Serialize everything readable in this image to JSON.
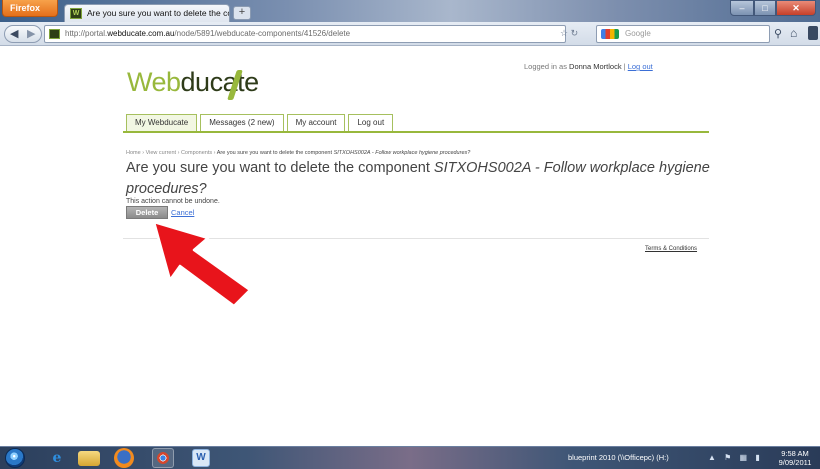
{
  "browser": {
    "app_button": "Firefox",
    "tab_title": "Are you sure you want to delete the com...",
    "new_tab_label": "+",
    "url_prefix": "http://portal.",
    "url_host": "webducate.com.au",
    "url_path": "/node/5891/webducate-components/41526/delete",
    "search_placeholder": "Google"
  },
  "header": {
    "logo_web": "Web",
    "logo_rest": "ducate",
    "logged_in_prefix": "Logged in as",
    "user_name": "Donna Mortlock",
    "separator": "|",
    "logout_link": "Log out"
  },
  "menu": {
    "items": [
      {
        "label": "My Webducate"
      },
      {
        "label": "Messages (2 new)"
      },
      {
        "label": "My account"
      },
      {
        "label": "Log out"
      }
    ]
  },
  "breadcrumb": {
    "home": "Home",
    "view_current": "View current",
    "components": "Components",
    "sep": "›",
    "current_prefix": "Are you sure you want to delete the component",
    "current_code": "SITXOHS002A - Follow workplace hygiene procedures?"
  },
  "main": {
    "heading_prefix": "Are you sure you want to delete the component",
    "heading_component": "SITXOHS002A - Follow workplace hygiene procedures?",
    "notice": "This action cannot be undone.",
    "delete_button": "Delete",
    "cancel_link": "Cancel"
  },
  "footer": {
    "terms_link": "Terms & Conditions"
  },
  "taskbar": {
    "status_text": "blueprint 2010 (\\\\Officepc) (H:)",
    "clock_time": "9:58 AM",
    "clock_date": "9/09/2011"
  },
  "colors": {
    "brand_green": "#98b83c",
    "brand_dark": "#2e3b19",
    "link_blue": "#3b6fd6",
    "arrow_red": "#e8141b"
  },
  "icons": [
    "firefox-icon",
    "back-icon",
    "forward-icon",
    "site-favicon",
    "bookmark-star-icon",
    "reload-icon",
    "google-icon",
    "search-icon",
    "home-icon",
    "start-orb-icon",
    "ie-icon",
    "folder-icon",
    "chrome-icon",
    "word-icon",
    "red-arrow-icon"
  ]
}
